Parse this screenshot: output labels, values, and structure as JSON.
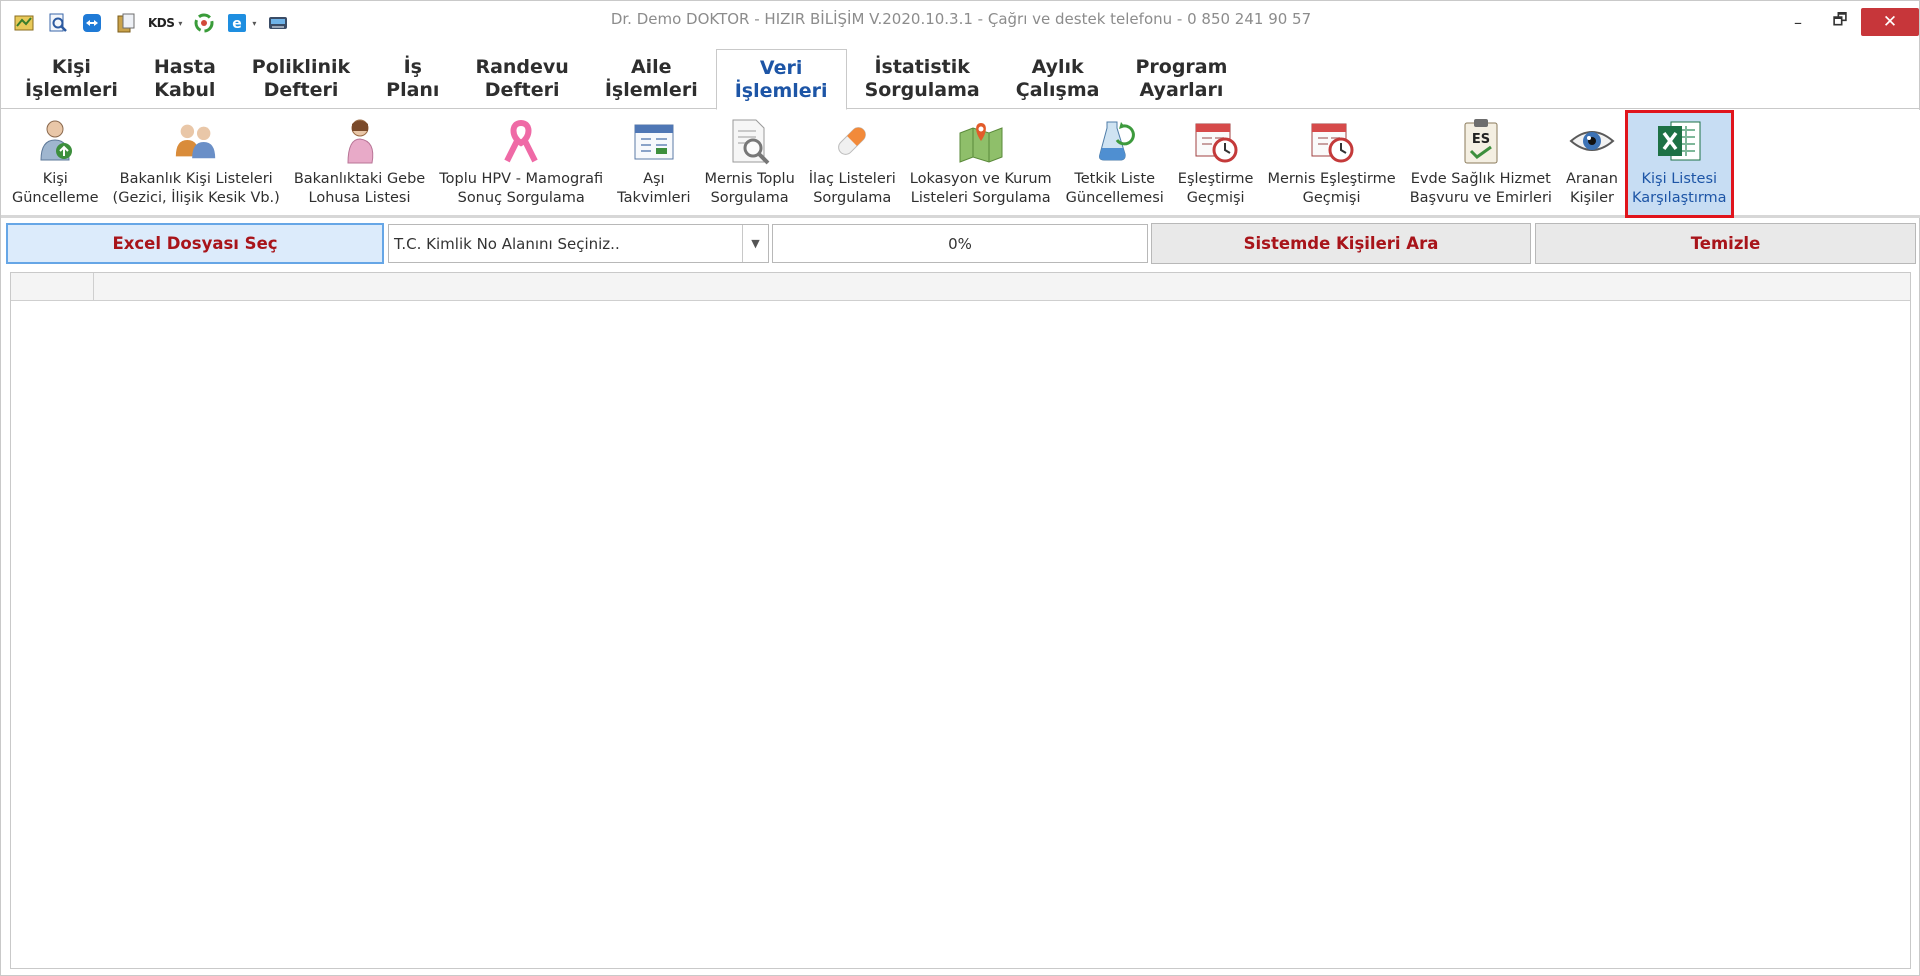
{
  "window": {
    "title": "Dr. Demo DOKTOR - HIZIR BİLİŞİM V.2020.10.3.1 - Çağrı ve destek telefonu - 0 850 241 90 57",
    "minimize_glyph": "–",
    "restore_glyph": "🗗",
    "close_glyph": "✕"
  },
  "quick_access": {
    "kds_label": "KDS",
    "dropdown_glyph": "▾"
  },
  "tabs": [
    {
      "label": "Kişi\nİşlemleri"
    },
    {
      "label": "Hasta\nKabul"
    },
    {
      "label": "Poliklinik\nDefteri"
    },
    {
      "label": "İş\nPlanı"
    },
    {
      "label": "Randevu\nDefteri"
    },
    {
      "label": "Aile\nİşlemleri"
    },
    {
      "label": "Veri\nİşlemleri",
      "active": true
    },
    {
      "label": "İstatistik\nSorgulama"
    },
    {
      "label": "Aylık\nÇalışma"
    },
    {
      "label": "Program\nAyarları"
    }
  ],
  "ribbon": [
    {
      "label": "Kişi\nGüncelleme",
      "icon": "person-update-icon"
    },
    {
      "label": "Bakanlık Kişi Listeleri\n(Gezici, İlişik Kesik Vb.)",
      "icon": "people-group-icon"
    },
    {
      "label": "Bakanlıktaki Gebe\nLohusa Listesi",
      "icon": "pregnant-woman-icon"
    },
    {
      "label": "Toplu HPV - Mamografi\nSonuç Sorgulama",
      "icon": "pink-ribbon-icon"
    },
    {
      "label": "Aşı\nTakvimleri",
      "icon": "calendar-icon"
    },
    {
      "label": "Mernis Toplu\nSorgulama",
      "icon": "document-search-icon"
    },
    {
      "label": "İlaç Listeleri\nSorgulama",
      "icon": "pill-icon"
    },
    {
      "label": "Lokasyon ve Kurum\nListeleri Sorgulama",
      "icon": "map-pin-icon"
    },
    {
      "label": "Tetkik Liste\nGüncellemesi",
      "icon": "lab-refresh-icon"
    },
    {
      "label": "Eşleştirme\nGeçmişi",
      "icon": "calendar-clock-icon"
    },
    {
      "label": "Mernis Eşleştirme\nGeçmişi",
      "icon": "calendar-clock-icon"
    },
    {
      "label": "Evde Sağlık Hizmet\nBaşvuru ve Emirleri",
      "icon": "es-clipboard-icon",
      "es_text": "ES"
    },
    {
      "label": "Aranan\nKişiler",
      "icon": "eye-icon"
    },
    {
      "label": "Kişi Listesi\nKarşılaştırma",
      "icon": "excel-icon",
      "selected": true
    }
  ],
  "command_row": {
    "excel_button": "Excel Dosyası Seç",
    "tc_select": {
      "value": "T.C. Kimlik No Alanını Seçiniz.."
    },
    "progress": {
      "text": "0%",
      "value": 0
    },
    "search_button": "Sistemde Kişileri Ara",
    "clear_button": "Temizle"
  },
  "colors": {
    "accent_blue": "#1d55a6",
    "button_text_red": "#a8141a",
    "highlight_red": "#e0141c",
    "close_red": "#c7363a",
    "selected_bg": "#c7ddf3",
    "excel_green": "#1e7145"
  }
}
